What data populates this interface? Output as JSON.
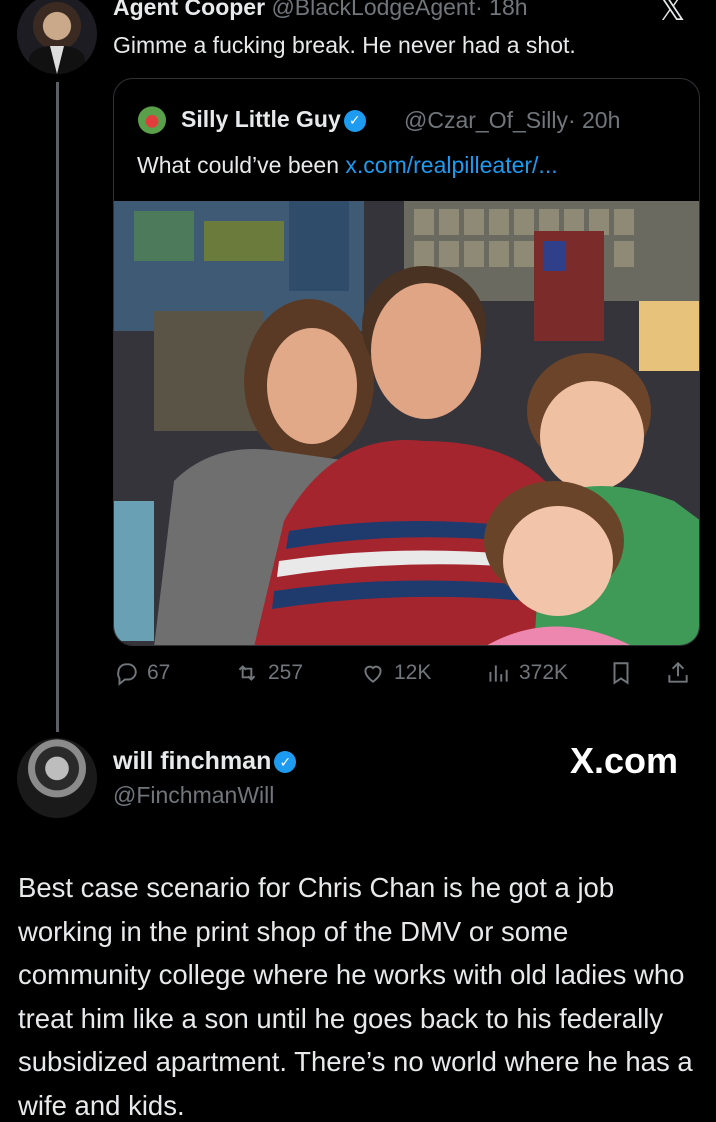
{
  "quoting_tweet": {
    "author_name": "Agent Cooper",
    "author_handle": "@BlackLodgeAgent",
    "time": "· 18h",
    "text": "Gimme a fucking break. He never had a shot.",
    "close_icon": "x-logo-icon"
  },
  "quoted_tweet": {
    "author_name": "Silly Little Guy",
    "author_handle": "@Czar_Of_Silly",
    "time": "· 20h",
    "text_prefix": "What could’ve been ",
    "link": "x.com/realpilleater/...",
    "verified_icon": "verified-badge-icon"
  },
  "engagement": {
    "replies": "67",
    "reposts": "257",
    "likes": "12K",
    "views": "372K",
    "bookmark_icon": "bookmark-icon",
    "share_icon": "share-icon"
  },
  "screenshot_tweet": {
    "author_name": "will finchman",
    "author_handle": "@FinchmanWill",
    "watermark": "X.com",
    "text": "Best case scenario for Chris Chan is he got a job working in the print shop of the DMV or some community college where he works with old ladies who treat him like a son until he goes back to his federally subsidized apartment. There’s no world where he has a wife and kids."
  },
  "colors": {
    "background": "#000000",
    "text": "#e7e9ea",
    "muted": "#71767b",
    "link": "#1d9bf0",
    "verified": "#1d9bf0",
    "border": "#2f3336"
  }
}
